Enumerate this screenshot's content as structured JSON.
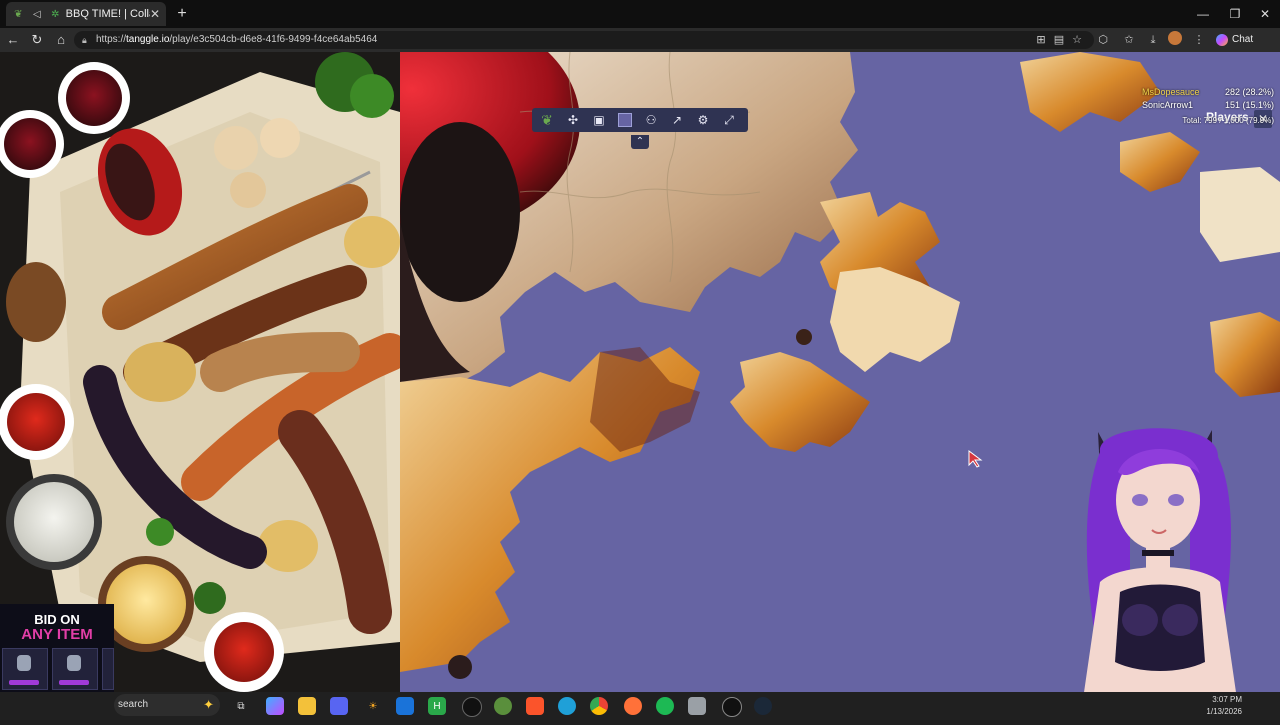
{
  "browser": {
    "tab_title": "BBQ TIME! | Collage Jigsa",
    "tab_close": "✕",
    "new_tab": "+",
    "url_prefix": "https://",
    "url_host": "tanggle.io",
    "url_path": "/play/e3c504cb-d6e8-41f6-9499-f4ce64ab5464",
    "chat_label": "Chat",
    "window_controls": [
      "—",
      "❐",
      "✕"
    ]
  },
  "puzzle": {
    "toolbar_icons": [
      "leaf-icon",
      "puzzle-piece-icon",
      "image-icon",
      "background-color-icon",
      "players-icon",
      "share-icon",
      "settings-icon",
      "fullscreen-icon"
    ],
    "background_color": "#6664a3",
    "collapse_glyph": "⌃"
  },
  "players": {
    "title": "Players",
    "close_glyph": "✕",
    "list": [
      {
        "name": "MsDopesauce",
        "score": "282 (28.2%)",
        "color": "#f0d34a"
      },
      {
        "name": "SonicArrow1",
        "score": "151 (15.1%)",
        "color": "#ffffff"
      }
    ],
    "totals": "Total: 799 / 1,000 (79.9%)"
  },
  "ad": {
    "line1": "BID ON",
    "line2": "ANY ITEM"
  },
  "taskbar": {
    "search_placeholder": "search",
    "time": "3:07 PM",
    "date": "1/13/2026",
    "apps": [
      "task-view",
      "copilot",
      "file-explorer",
      "discord",
      "game-launcher",
      "outlook",
      "hotkeys",
      "obs",
      "xbox",
      "brave",
      "edge",
      "chrome",
      "firefox",
      "spotify",
      "mail",
      "github",
      "steam"
    ]
  }
}
